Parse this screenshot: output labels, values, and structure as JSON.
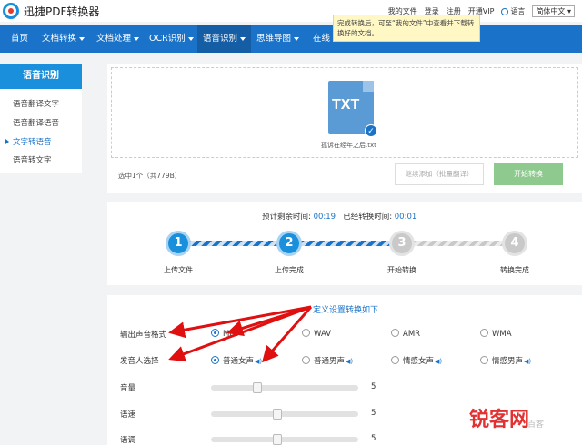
{
  "header": {
    "brand": "迅捷PDF转换器",
    "links": [
      "我的文件",
      "登录",
      "注册",
      "开通VIP"
    ],
    "language_label": "语言",
    "language_value": "简体中文"
  },
  "tooltip": "完成转换后，可至“我的文件”中查看并下载转换好的文档。",
  "nav": {
    "items": [
      {
        "label": "首页"
      },
      {
        "label": "文档转换"
      },
      {
        "label": "文档处理"
      },
      {
        "label": "OCR识别"
      },
      {
        "label": "语音识别"
      },
      {
        "label": "思维导图"
      },
      {
        "label": "在线"
      }
    ]
  },
  "sidebar": {
    "title": "语音识别",
    "items": [
      {
        "label": "语音翻译文字"
      },
      {
        "label": "语音翻译语音"
      },
      {
        "label": "文字转语音"
      },
      {
        "label": "语音转文字"
      }
    ]
  },
  "upload": {
    "file_type": "TXT",
    "file_name": "孤诉在经年之后.txt",
    "count_text": "选中1个（共779B）",
    "add_button": "继续添加（批量翻译）",
    "start_button": "开始转换"
  },
  "progress": {
    "remaining_label": "预计剩余时间:",
    "remaining_value": "00:19",
    "elapsed_label": "已经转换时间:",
    "elapsed_value": "00:01",
    "steps": [
      {
        "num": "1",
        "label": "上传文件",
        "done": true
      },
      {
        "num": "2",
        "label": "上传完成",
        "done": true
      },
      {
        "num": "3",
        "label": "开始转换",
        "done": false
      },
      {
        "num": "4",
        "label": "转换完成",
        "done": false
      }
    ]
  },
  "settings": {
    "title": "定义设置转换如下",
    "format_label": "输出声音格式",
    "formats": [
      "MP3",
      "WAV",
      "AMR",
      "WMA"
    ],
    "format_selected": "MP3",
    "voice_label": "发音人选择",
    "voices": [
      "普通女声",
      "普通男声",
      "情感女声",
      "情感男声"
    ],
    "voice_selected": "普通女声",
    "sliders": [
      {
        "label": "音量",
        "value": "5",
        "level": 0.3
      },
      {
        "label": "语速",
        "value": "5",
        "level": 0.45
      },
      {
        "label": "语调",
        "value": "5",
        "level": 0.45
      }
    ]
  },
  "watermark": {
    "main": "锐客网",
    "sub": "百客"
  },
  "colors": {
    "brand_blue": "#1a73c9",
    "arrow_red": "#e01010",
    "start_green": "#8ec98e"
  }
}
